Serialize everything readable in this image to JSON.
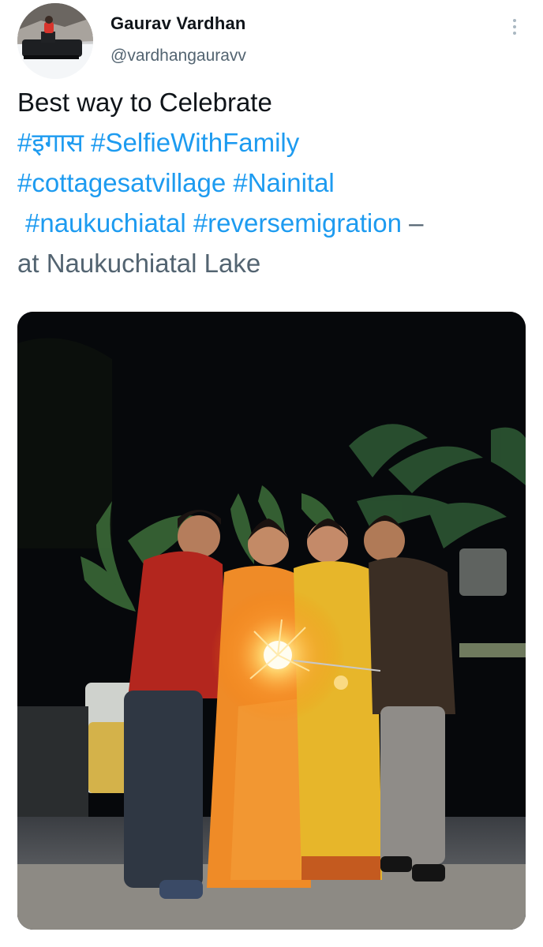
{
  "author": {
    "name": "Gaurav Vardhan",
    "handle": "@vardhangauravv"
  },
  "tweet": {
    "line1": "Best way to Celebrate",
    "line2_hashtags": [
      "#इगास",
      "#SelfieWithFamily"
    ],
    "line3_hashtags": [
      "#cottagesatvillage",
      "#Nainital"
    ],
    "line4_hashtags": [
      "#naukuchiatal",
      "#reversemigration"
    ],
    "line4_suffix": " –",
    "location_text": "at Naukuchiatal Lake"
  },
  "icons": {
    "more": "more-vertical-icon"
  },
  "colors": {
    "hashtag": "#1d9bf0",
    "text": "#0f1419",
    "secondary": "#536471"
  }
}
